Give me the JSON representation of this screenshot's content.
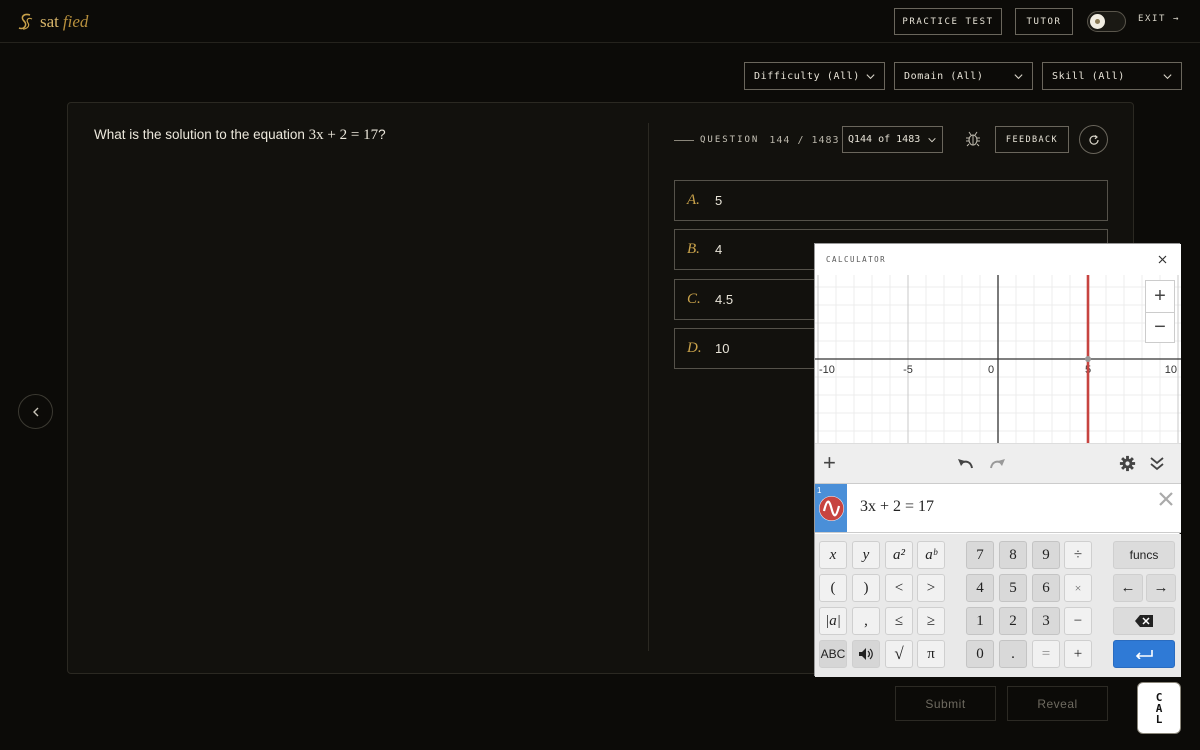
{
  "header": {
    "logo_text_1": "sat",
    "logo_text_2": "fied",
    "practice_test": "PRACTICE TEST",
    "tutor": "TUTOR",
    "exit": "EXIT →"
  },
  "filters": {
    "difficulty": "Difficulty (All)",
    "domain": "Domain (All)",
    "skill": "Skill (All)"
  },
  "question": {
    "prompt": "What is the solution to the equation",
    "equation": "3x + 2 = 17",
    "end": "?",
    "label": "QUESTION",
    "count": "144 / 1483",
    "selector": "Q144 of 1483",
    "feedback": "FEEDBACK"
  },
  "choices": [
    {
      "letter": "A.",
      "value": "5"
    },
    {
      "letter": "B.",
      "value": "4"
    },
    {
      "letter": "C.",
      "value": "4.5"
    },
    {
      "letter": "D.",
      "value": "10"
    }
  ],
  "actions": {
    "submit": "Submit",
    "reveal": "Reveal",
    "cal": [
      "C",
      "A",
      "L"
    ]
  },
  "calculator": {
    "title": "CALCULATOR",
    "axis_labels": [
      "-10",
      "-5",
      "0",
      "5",
      "10"
    ],
    "x_range": [
      -10,
      10
    ],
    "vertical_line_x": 5,
    "line_color": "#c74440",
    "expression_index": "1",
    "expression": "3x + 2 = 17",
    "keys": {
      "row1": [
        "x",
        "y",
        "a²",
        "aᵇ",
        "7",
        "8",
        "9",
        "÷",
        "funcs"
      ],
      "row2": [
        "(",
        ")",
        "<",
        ">",
        "4",
        "5",
        "6",
        "×",
        "←",
        "→"
      ],
      "row3": [
        "|a|",
        ",",
        "≤",
        "≥",
        "1",
        "2",
        "3",
        "−"
      ],
      "row4": [
        "ABC",
        "√",
        "π",
        "0",
        ".",
        "=",
        "+"
      ]
    }
  },
  "colors": {
    "accent_gold": "#c9a24a",
    "background": "#0c0b08",
    "enter_blue": "#2f7ad6"
  }
}
